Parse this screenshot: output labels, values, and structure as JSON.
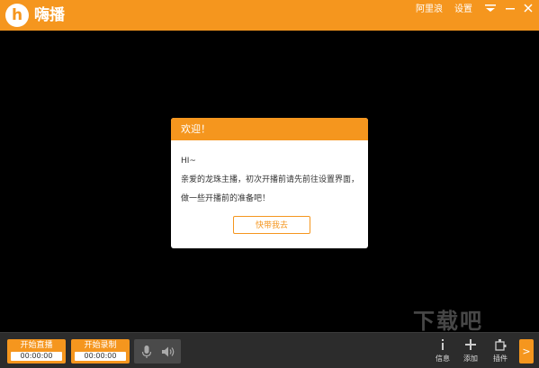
{
  "app": {
    "name": "嗨播",
    "logo_letter": "h"
  },
  "titlebar": {
    "user": "阿里浪",
    "settings": "设置"
  },
  "dialog": {
    "title": "欢迎！",
    "greeting": "HI~",
    "line1": "亲爱的龙珠主播，初次开播前请先前往设置界面，",
    "line2": "做一些开播前的准备吧！",
    "button": "快带我去"
  },
  "bottombar": {
    "live": {
      "label": "开始直播",
      "time": "00:00:00"
    },
    "record": {
      "label": "开始录制",
      "time": "00:00:00"
    },
    "tools": [
      {
        "icon": "info-icon",
        "label": "信息"
      },
      {
        "icon": "plus-icon",
        "label": "添加"
      },
      {
        "icon": "plugin-icon",
        "label": "插件"
      }
    ],
    "expand_symbol": ">"
  },
  "watermark": "下载吧",
  "colors": {
    "accent": "#f5961e",
    "background": "#000000",
    "bottombar": "#2c2c2c"
  }
}
